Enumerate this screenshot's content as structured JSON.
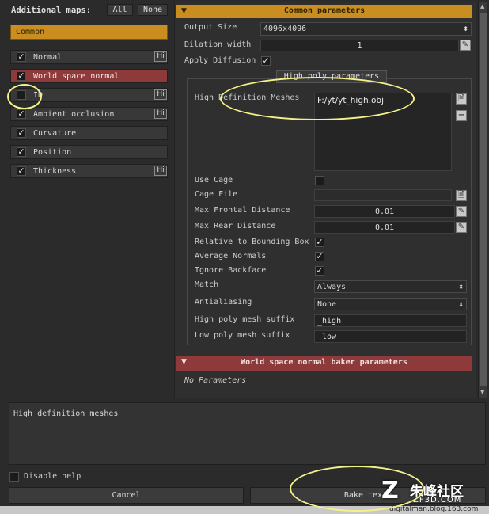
{
  "left": {
    "title": "Additional maps:",
    "all_label": "All",
    "none_label": "None",
    "common_label": "Common",
    "maps": [
      {
        "label": "Normal",
        "checked": true,
        "hi": "Hi"
      },
      {
        "label": "World space normal",
        "checked": true,
        "hi": "",
        "active": true
      },
      {
        "label": "ID",
        "checked": false,
        "hi": "Hi"
      },
      {
        "label": "Ambient occlusion",
        "checked": true,
        "hi": "Hi"
      },
      {
        "label": "Curvature",
        "checked": true,
        "hi": ""
      },
      {
        "label": "Position",
        "checked": true,
        "hi": ""
      },
      {
        "label": "Thickness",
        "checked": true,
        "hi": "Hi"
      }
    ]
  },
  "common": {
    "header": "Common parameters",
    "output_size_label": "Output Size",
    "output_size_value": "4096x4096",
    "dilation_label": "Dilation width",
    "dilation_value": "1",
    "apply_diffusion_label": "Apply Diffusion",
    "highpoly_tab": "High poly parameters",
    "hd_meshes_label": "High Definition Meshes",
    "hd_mesh_path": "F:/yt/yt_high.obj",
    "use_cage_label": "Use Cage",
    "cage_file_label": "Cage File",
    "max_frontal_label": "Max Frontal Distance",
    "max_frontal_value": "0.01",
    "max_rear_label": "Max Rear Distance",
    "max_rear_value": "0.01",
    "rel_bbox_label": "Relative to Bounding Box",
    "avg_normals_label": "Average Normals",
    "ignore_backface_label": "Ignore Backface",
    "match_label": "Match",
    "match_value": "Always",
    "antialiasing_label": "Antialiasing",
    "antialiasing_value": "None",
    "hp_suffix_label": "High poly mesh suffix",
    "hp_suffix_value": "_high",
    "lp_suffix_label": "Low poly mesh suffix",
    "lp_suffix_value": "_low"
  },
  "wsn": {
    "header": "World space normal baker parameters",
    "no_params": "No Parameters"
  },
  "help": {
    "text": "High definition meshes",
    "disable_label": "Disable help"
  },
  "footer": {
    "cancel": "Cancel",
    "bake": "Bake textu",
    "watermark_logo": "朱峰社区",
    "watermark_site": "ZF3D.COM",
    "watermark_blog": "digitalman.blog.163.com"
  },
  "colors": {
    "accent_orange": "#c98e1f",
    "accent_red": "#8f3a3a",
    "annotation_yellow": "#f4f08a"
  }
}
